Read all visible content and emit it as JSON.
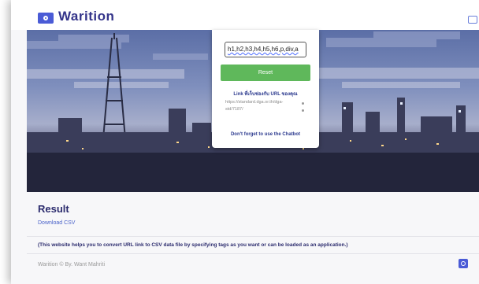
{
  "header": {
    "brand": "Warition",
    "logo_icon": "app-logo-icon",
    "top_right_icon": "window-icon"
  },
  "converter": {
    "tags_value": "h1,h2,h3,h4,h5,h6,p,div,a",
    "reset_label": "Reset",
    "link_label": "Link ที่เก็บช่องกับ URL ของคุณ",
    "url_text": "https://standard.dga.or.th/dga-std/7187/",
    "chatbot_note": "Don't forget to use the Chatbot"
  },
  "result": {
    "title": "Result",
    "download_label": "Download CSV"
  },
  "info_note": "(This website helps you to convert URL link to CSV data file by specifying tags as you want or can be loaded as an application.)",
  "footer": {
    "text": "Warition © By. Want Mahriti",
    "icon": "app-logo-icon"
  },
  "colors": {
    "accent": "#5fb85b",
    "brand": "#2c2c6e",
    "logo": "#4a5bd6"
  }
}
